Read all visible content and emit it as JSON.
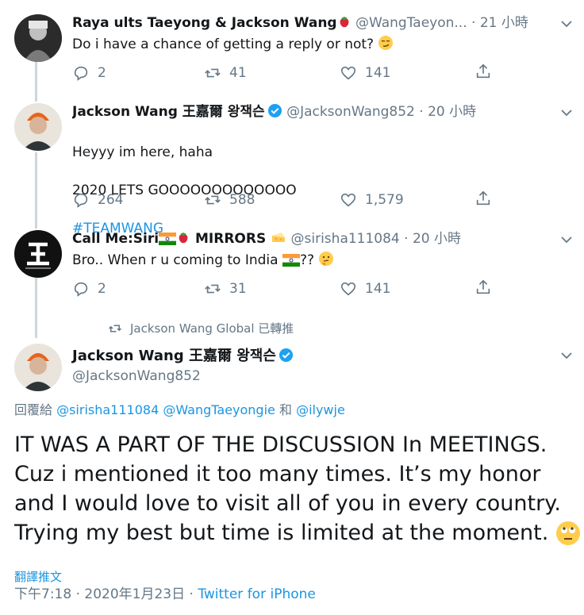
{
  "tweets": [
    {
      "name": "Raya ults Taeyong & Jackson Wang",
      "name_emoji": "strawberry",
      "handle": "@WangTaeyon...",
      "time": "· 21 小時",
      "text": "Do i have a chance of getting a reply or not? ",
      "text_emoji": "smirk-face",
      "replies": "2",
      "retweets": "41",
      "likes": "141"
    },
    {
      "name": "Jackson Wang 王嘉爾 왕잭슨",
      "verified": true,
      "handle": "@JacksonWang852",
      "time": "· 20 小時",
      "text_line1": "Heyyy im here, haha",
      "text_line2": "2020 LETS GOOOOOOOOOOOOO",
      "hashtag": "#TEAMWANG",
      "replies": "264",
      "retweets": "588",
      "likes": "1,579"
    },
    {
      "name_part1": "Call Me:Siri",
      "name_part2": " MIRRORS ",
      "name_emojis": [
        "india-flag",
        "strawberry",
        "cheese"
      ],
      "handle": "@sirisha111084",
      "time": "· 20 小時",
      "text_part1": "Bro.. When r u coming to India ",
      "text_part2": "?? ",
      "text_emojis": [
        "india-flag",
        "thinking-face"
      ],
      "replies": "2",
      "retweets": "31",
      "likes": "141"
    }
  ],
  "retweet_note": "Jackson Wang Global 已轉推",
  "main_tweet": {
    "name": "Jackson Wang 王嘉爾 왕잭슨",
    "verified": true,
    "handle": "@JacksonWang852",
    "replying_prefix": "回覆給 ",
    "replying_to": [
      "@sirisha111084",
      "@WangTaeyongie",
      "@ilywje"
    ],
    "replying_and": " 和 ",
    "text": "IT WAS A PART OF THE DISCUSSION In MEETINGS. Cuz i mentioned it too many times. It’s my honor and I would love to visit all of you in every country. Trying my best but time is limited at the moment. ",
    "text_emoji": "face-with-rolling-eyes",
    "translate": "翻譯推文",
    "timestamp": "下午7:18 · 2020年1月23日 · ",
    "source": "Twitter for iPhone"
  },
  "colors": {
    "accent": "#1b95e0",
    "muted": "#657786",
    "verified": "#1da1f2",
    "thread_line": "#ccd6dd"
  }
}
